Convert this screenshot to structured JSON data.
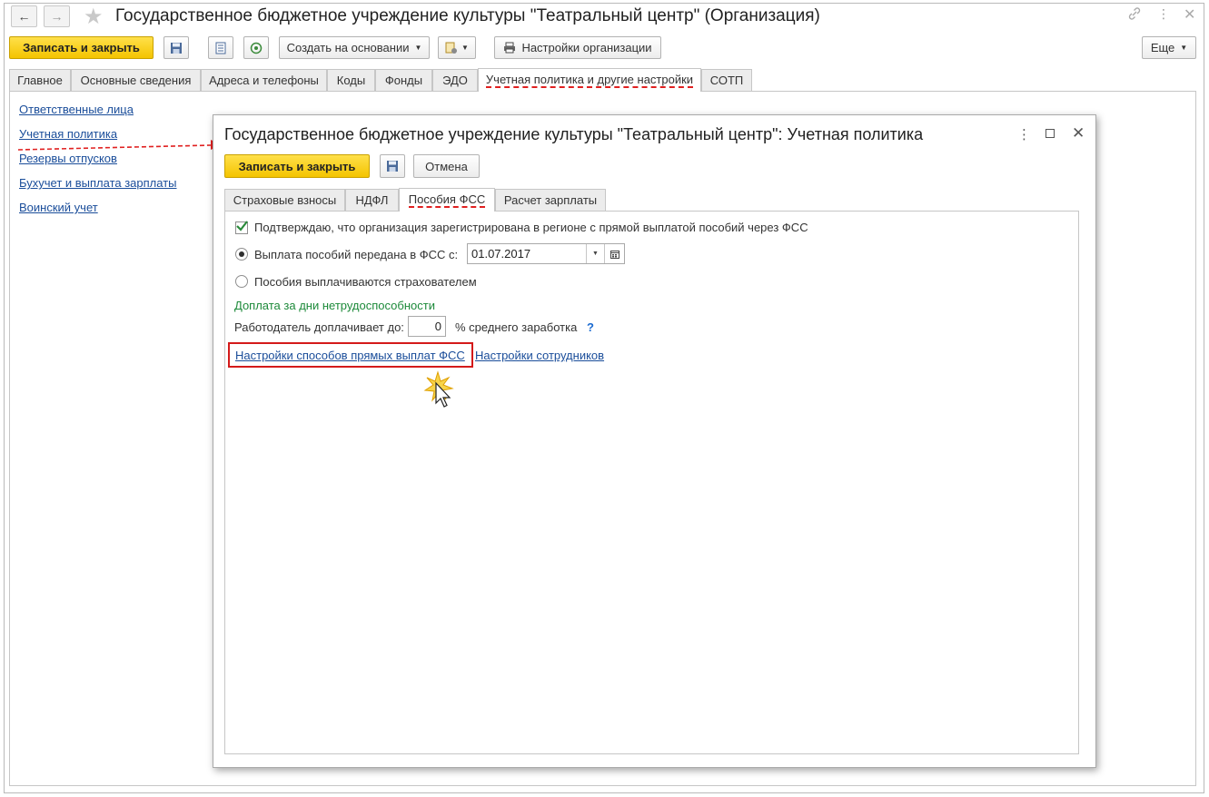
{
  "window": {
    "title": "Государственное бюджетное учреждение культуры \"Театральный центр\" (Организация)"
  },
  "toolbar": {
    "save_close": "Записать и закрыть",
    "create_based": "Создать на основании",
    "org_settings": "Настройки организации",
    "more": "Еще"
  },
  "tabs": [
    {
      "label": "Главное"
    },
    {
      "label": "Основные сведения"
    },
    {
      "label": "Адреса и телефоны"
    },
    {
      "label": "Коды"
    },
    {
      "label": "Фонды"
    },
    {
      "label": "ЭДО"
    },
    {
      "label": "Учетная политика и другие настройки"
    },
    {
      "label": "СОТП"
    }
  ],
  "sidebar": {
    "links": [
      {
        "label": "Ответственные лица"
      },
      {
        "label": "Учетная политика"
      },
      {
        "label": "Резервы отпусков"
      },
      {
        "label": "Бухучет и выплата зарплаты"
      },
      {
        "label": "Воинский учет"
      }
    ]
  },
  "dialog": {
    "title": "Государственное бюджетное учреждение культуры \"Театральный центр\": Учетная политика",
    "save_close": "Записать и закрыть",
    "cancel": "Отмена",
    "tabs": [
      {
        "label": "Страховые взносы"
      },
      {
        "label": "НДФЛ"
      },
      {
        "label": "Пособия ФСС"
      },
      {
        "label": "Расчет зарплаты"
      }
    ],
    "confirm_text": "Подтверждаю, что организация зарегистрирована в регионе с прямой выплатой пособий через ФСС",
    "radio_fss_label": "Выплата пособий передана в ФСС с:",
    "radio_fss_date": "01.07.2017",
    "radio_insurer_label": "Пособия выплачиваются страхователем",
    "section_title": "Доплата за дни нетрудоспособности",
    "employer_label": "Работодатель доплачивает до:",
    "employer_value": "0",
    "employer_suffix": "% среднего заработка",
    "help": "?",
    "link_direct": "Настройки способов прямых выплат ФСС",
    "link_employees": "Настройки сотрудников"
  }
}
